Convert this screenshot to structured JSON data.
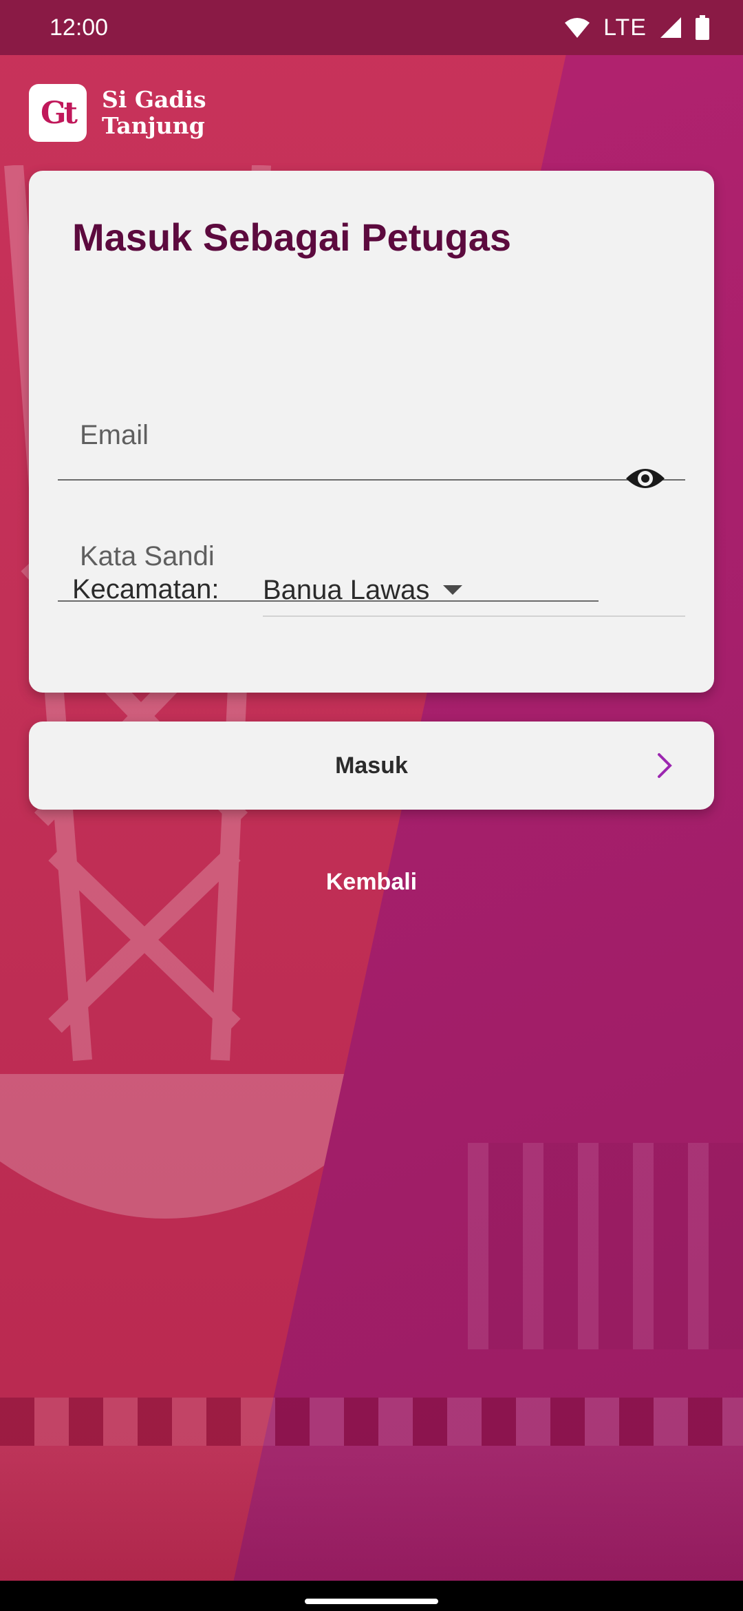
{
  "status_bar": {
    "time": "12:00",
    "network": "LTE",
    "icons": [
      "wifi-icon",
      "signal-icon",
      "battery-icon"
    ]
  },
  "logo": {
    "mark": "Gt",
    "line1": "Si Gadis",
    "line2": "Tanjung"
  },
  "login_card": {
    "title": "Masuk Sebagai Petugas",
    "email": {
      "placeholder": "Email",
      "value": ""
    },
    "password": {
      "placeholder": "Kata Sandi",
      "value": "",
      "toggle_icon": "eye-icon"
    },
    "kecamatan": {
      "label": "Kecamatan:",
      "selected": "Banua Lawas"
    }
  },
  "submit_button": {
    "label": "Masuk",
    "icon": "chevron-right-icon"
  },
  "back_link": {
    "label": "Kembali"
  },
  "colors": {
    "primary_dark": "#5c0a3e",
    "accent": "#9c27b0",
    "status_bar": "#8a1a45",
    "card": "#f2f2f2"
  }
}
